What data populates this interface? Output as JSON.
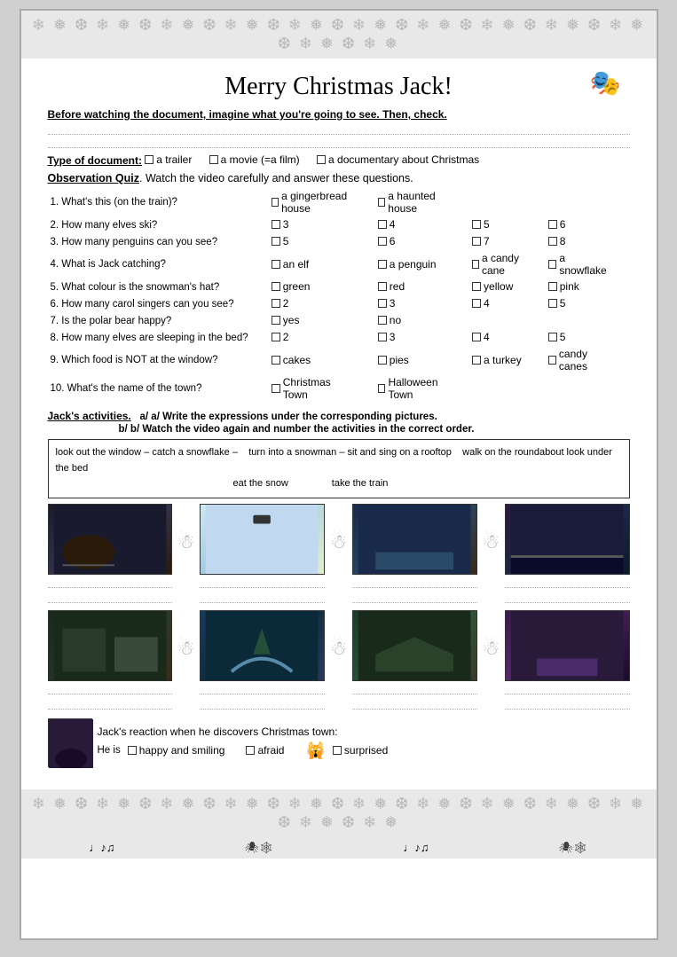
{
  "page": {
    "title": "Merry Christmas Jack!",
    "snowflake_char": "❄",
    "border_snowflakes": "❄ ❅ ❆ ❄ ❅ ❆ ❄ ❅ ❆ ❄ ❅ ❆ ❄ ❅ ❆ ❄ ❅ ❆ ❄ ❅ ❆ ❄ ❅ ❆ ❄ ❅ ❆ ❄ ❅ ❆ ❄ ❅ ❆ ❄ ❅"
  },
  "before_section": {
    "instruction": "Before watching the document, imagine what you're going to see. Then, check.",
    "type_label": "Type of document:",
    "options": [
      {
        "label": "a trailer"
      },
      {
        "label": "a movie (=a film)"
      },
      {
        "label": "a documentary about Christmas"
      }
    ]
  },
  "observation": {
    "title_bold": "Observation Quiz",
    "title_rest": ". Watch the video carefully and answer these questions.",
    "questions": [
      {
        "q": "1. What's this (on the train)?",
        "options": [
          "a gingerbread house",
          "a haunted house"
        ]
      },
      {
        "q": "2. How many elves ski?",
        "options": [
          "3",
          "4",
          "5",
          "6"
        ]
      },
      {
        "q": "3. How many penguins can you see?",
        "options": [
          "5",
          "6",
          "7",
          "8"
        ]
      },
      {
        "q": "4. What is Jack catching?",
        "options": [
          "an elf",
          "a penguin",
          "a candy cane",
          "a snowflake"
        ]
      },
      {
        "q": "5. What colour is the snowman's hat?",
        "options": [
          "green",
          "red",
          "yellow",
          "pink"
        ]
      },
      {
        "q": "6. How many carol singers can you see?",
        "options": [
          "2",
          "3",
          "4",
          "5"
        ]
      },
      {
        "q": "7. Is the polar bear happy?",
        "options": [
          "yes",
          "no"
        ]
      },
      {
        "q": "8. How many elves are sleeping in the bed?",
        "options": [
          "2",
          "3",
          "4",
          "5"
        ]
      },
      {
        "q": "9. Which food is NOT at the window?",
        "options": [
          "cakes",
          "pies",
          "a turkey",
          "candy canes"
        ]
      },
      {
        "q": "10. What's the name of the town?",
        "options": [
          "Christmas Town",
          "Halloween Town"
        ]
      }
    ]
  },
  "activities": {
    "title": "Jack's activities.",
    "instruction_a": "a/ Write the expressions under the corresponding pictures.",
    "instruction_b": "b/ Watch the video again and number the activities in the correct order.",
    "expressions": [
      "look out the window – catch a snowflake –",
      "turn into a snowman – sit and sing on a rooftop",
      "walk on the roundabout  look under the bed",
      "eat the snow",
      "take the train"
    ]
  },
  "reaction": {
    "instruction": "Jack's reaction when he discovers Christmas town:",
    "line": "He is",
    "options": [
      {
        "label": "happy and smiling"
      },
      {
        "label": "afraid"
      },
      {
        "label": "surprised"
      }
    ]
  }
}
